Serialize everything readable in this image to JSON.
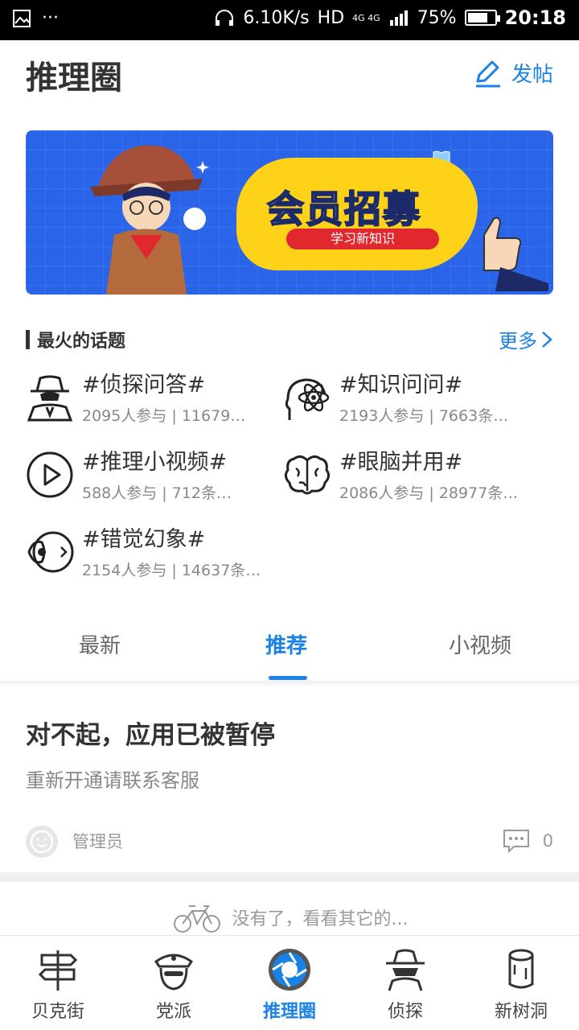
{
  "status_bar": {
    "speed": "6.10K/s",
    "network": "HD",
    "network_type": "4G 4G",
    "battery": "75%",
    "battery_level": 0.75,
    "time": "20:18"
  },
  "header": {
    "title": "推理圈",
    "post_label": "发帖"
  },
  "banner": {
    "headline": "会员招募",
    "subtitle": "学习新知识"
  },
  "hot_topics": {
    "section_title": "最火的话题",
    "more_label": "更多",
    "items": [
      {
        "name": "#侦探问答#",
        "stats": "2095人参与 | 11679…",
        "icon": "detective-icon"
      },
      {
        "name": "#知识问问#",
        "stats": "2193人参与 | 7663条…",
        "icon": "atom-head-icon"
      },
      {
        "name": "#推理小视频#",
        "stats": "588人参与 | 712条…",
        "icon": "play-icon"
      },
      {
        "name": "#眼脑并用#",
        "stats": "2086人参与 | 28977条…",
        "icon": "brain-icon"
      },
      {
        "name": "#错觉幻象#",
        "stats": "2154人参与 | 14637条…",
        "icon": "eye-icon"
      }
    ]
  },
  "tabs": {
    "items": [
      "最新",
      "推荐",
      "小视频"
    ],
    "active": "推荐"
  },
  "post": {
    "title": "对不起，应用已被暂停",
    "description": "重新开通请联系客服",
    "author": "管理员",
    "comment_count": "0"
  },
  "end_message": "没有了，看看其它的...",
  "bottom_nav": {
    "items": [
      {
        "label": "贝克街",
        "icon": "signpost-icon"
      },
      {
        "label": "党派",
        "icon": "police-icon"
      },
      {
        "label": "推理圈",
        "icon": "lens-icon"
      },
      {
        "label": "侦探",
        "icon": "spy-icon"
      },
      {
        "label": "新树洞",
        "icon": "log-icon"
      }
    ],
    "active": "推理圈"
  },
  "colors": {
    "accent": "#1a82e6",
    "banner_bg": "#2a64e8",
    "banner_plate": "#ffd21a"
  }
}
